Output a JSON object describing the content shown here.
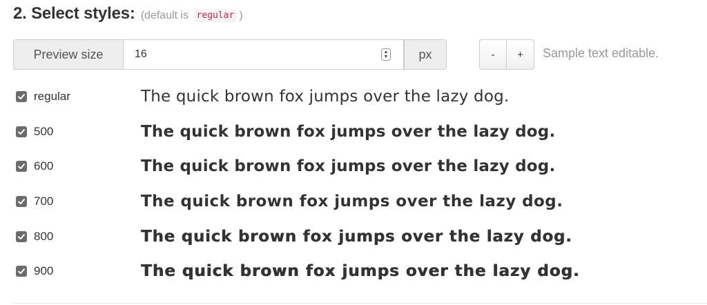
{
  "header": {
    "title": "2. Select styles:",
    "note_prefix": "(default is",
    "default_code": "regular",
    "note_suffix": ")"
  },
  "preview": {
    "label": "Preview size",
    "value": "16",
    "unit": "px"
  },
  "controls": {
    "minus_label": "-",
    "plus_label": "+",
    "sample_note": "Sample text editable."
  },
  "sample_text": "The quick brown fox jumps over the lazy dog.",
  "styles": [
    {
      "label": "regular",
      "checked": true
    },
    {
      "label": "500",
      "checked": true
    },
    {
      "label": "600",
      "checked": true
    },
    {
      "label": "700",
      "checked": true
    },
    {
      "label": "800",
      "checked": true
    },
    {
      "label": "900",
      "checked": true
    }
  ],
  "colors": {
    "checkbox": "#6b6b6b",
    "code_text": "#c7254e",
    "muted_text": "#999999"
  }
}
